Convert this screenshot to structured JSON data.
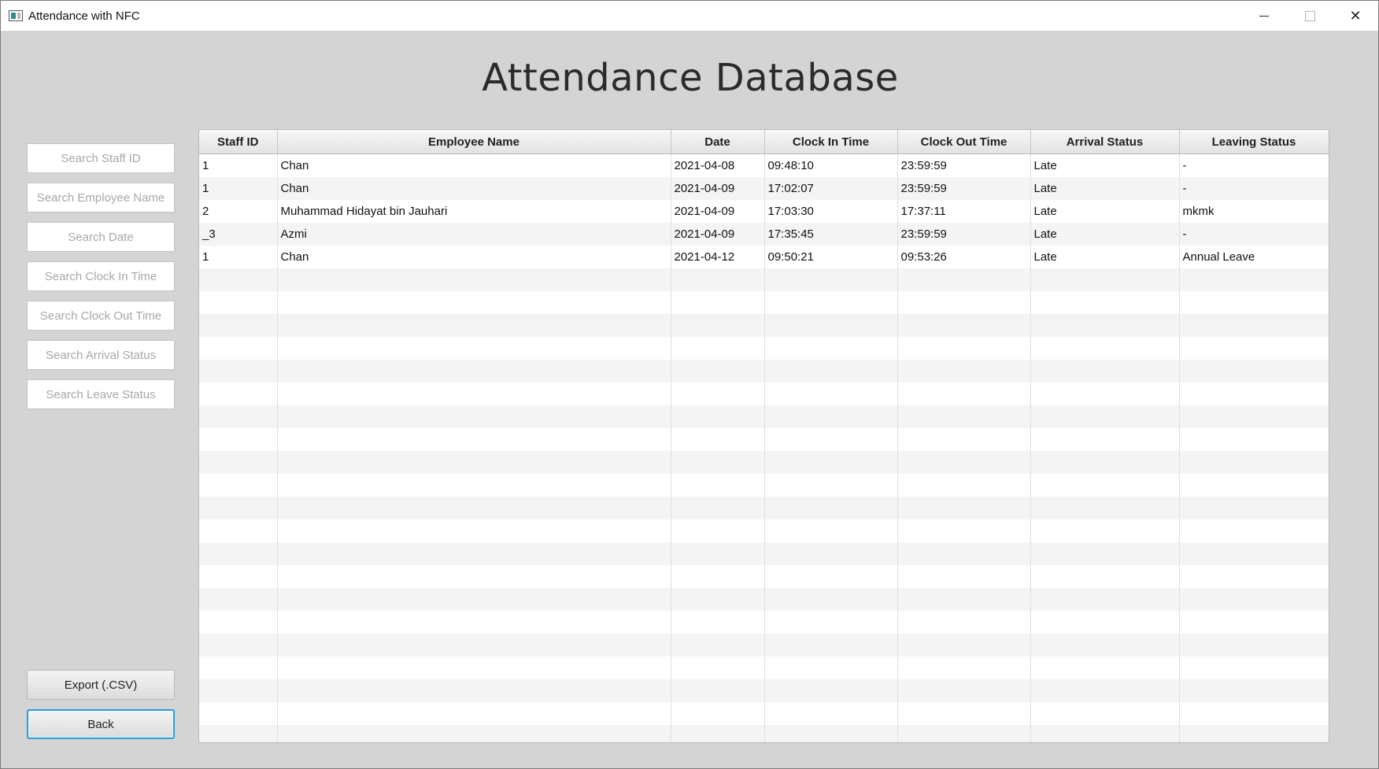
{
  "window": {
    "title": "Attendance with NFC",
    "controls": {
      "minimize": "minimize-icon",
      "maximize": "maximize-icon",
      "close": "close-icon"
    }
  },
  "page": {
    "title": "Attendance Database"
  },
  "search": {
    "staff_id": "Search Staff ID",
    "employee_name": "Search Employee Name",
    "date": "Search Date",
    "clock_in": "Search Clock In Time",
    "clock_out": "Search Clock Out Time",
    "arrival_status": "Search Arrival Status",
    "leave_status": "Search Leave Status"
  },
  "buttons": {
    "export": "Export (.CSV)",
    "back": "Back"
  },
  "table": {
    "columns": [
      "Staff ID",
      "Employee Name",
      "Date",
      "Clock In Time",
      "Clock Out Time",
      "Arrival Status",
      "Leaving Status"
    ],
    "rows": [
      [
        "1",
        "Chan",
        "2021-04-08",
        "09:48:10",
        "23:59:59",
        "Late",
        "-"
      ],
      [
        "1",
        "Chan",
        "2021-04-09",
        "17:02:07",
        "23:59:59",
        "Late",
        "-"
      ],
      [
        "2",
        "Muhammad Hidayat bin Jauhari",
        "2021-04-09",
        "17:03:30",
        "17:37:11",
        "Late",
        "mkmk"
      ],
      [
        "_3",
        "Azmi",
        "2021-04-09",
        "17:35:45",
        "23:59:59",
        "Late",
        "-"
      ],
      [
        "1",
        "Chan",
        "2021-04-12",
        "09:50:21",
        "09:53:26",
        "Late",
        "Annual Leave"
      ]
    ]
  },
  "colors": {
    "background": "#d4d4d4",
    "focus_border": "#2a9fd6"
  }
}
